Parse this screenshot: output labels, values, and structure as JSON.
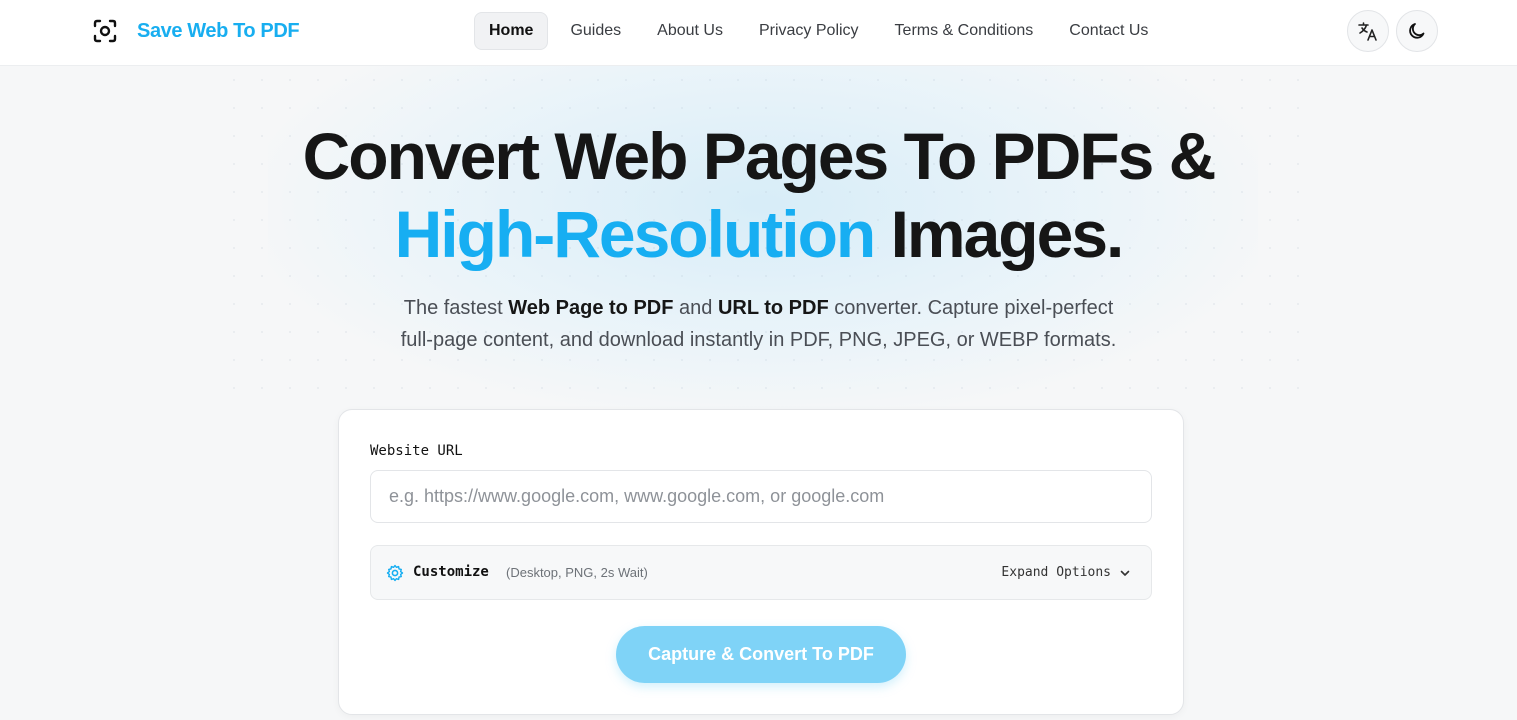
{
  "brand": {
    "name": "Save Web To PDF",
    "color": "#18aef0",
    "icon": "focus-camera-icon"
  },
  "nav": {
    "items": [
      {
        "label": "Home",
        "active": true
      },
      {
        "label": "Guides",
        "active": false
      },
      {
        "label": "About Us",
        "active": false
      },
      {
        "label": "Privacy Policy",
        "active": false
      },
      {
        "label": "Terms & Conditions",
        "active": false
      },
      {
        "label": "Contact Us",
        "active": false
      }
    ],
    "actions": [
      {
        "icon": "translate-icon"
      },
      {
        "icon": "moon-icon"
      }
    ]
  },
  "hero": {
    "line1": "Convert Web Pages To PDFs &",
    "line2_accent": "High-Resolution",
    "line2_rest": " Images.",
    "accent_color": "#17aef2",
    "sub1_a": "The fastest ",
    "sub1_b": "Web Page to PDF",
    "sub1_c": " and ",
    "sub1_d": "URL to PDF",
    "sub1_e": " converter. Capture pixel-perfect",
    "sub2": "full-page content, and download instantly in PDF, PNG, JPEG, or WEBP formats."
  },
  "form": {
    "url_label": "Website URL",
    "url_placeholder": "e.g. https://www.google.com, www.google.com, or google.com",
    "url_value": "",
    "customize_title": "Customize",
    "customize_meta": "(Desktop, PNG, 2s Wait)",
    "expand_label": "Expand Options",
    "submit_label": "Capture & Convert To PDF",
    "submit_color": "#7fd3f7"
  }
}
